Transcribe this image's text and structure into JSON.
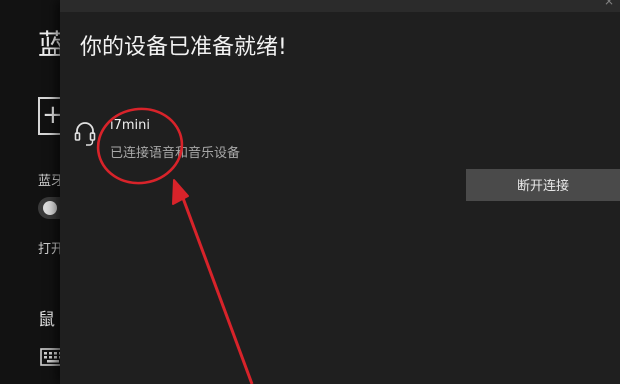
{
  "background_window": {
    "title": "蓝",
    "add_button_icon": "+",
    "bluetooth_label": "蓝牙",
    "toggle_state_label": "打开",
    "section_heading": "鼠",
    "keyboard_icon": "keyboard-icon"
  },
  "dialog": {
    "heading": "你的设备已准备就绪!",
    "close_icon": "×",
    "device": {
      "icon": "headset-icon",
      "name": "i7mini",
      "status": "已连接语音和音乐设备"
    },
    "disconnect_label": "断开连接"
  },
  "annotation": {
    "color": "#d8232a",
    "shape": "circle-and-arrow"
  }
}
